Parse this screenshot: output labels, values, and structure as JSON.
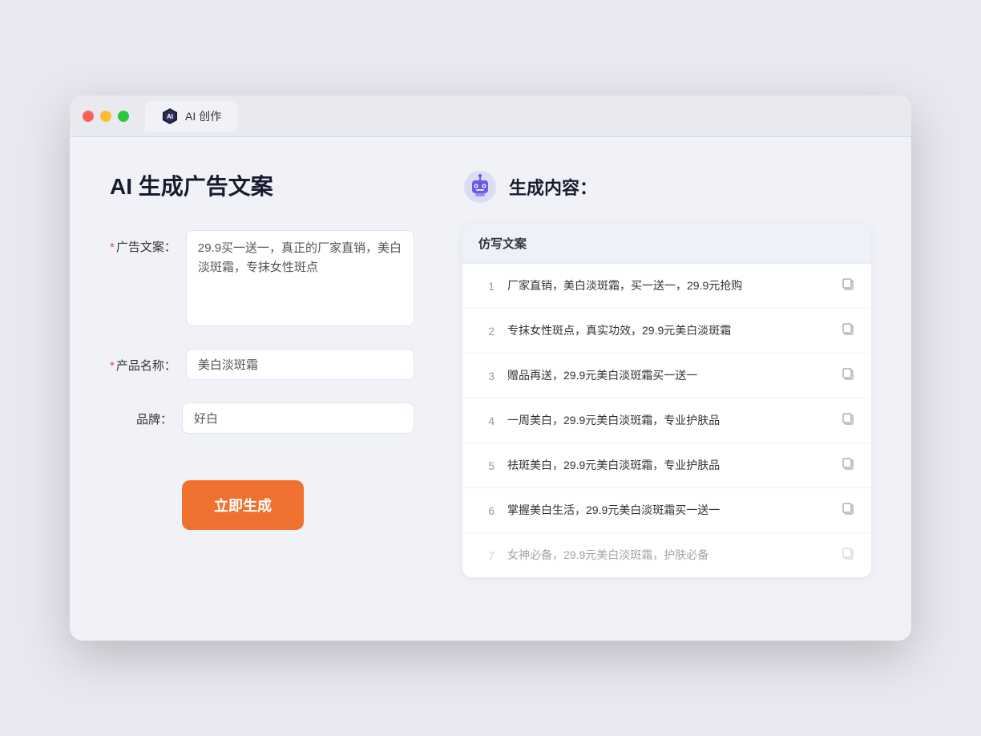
{
  "window": {
    "tab_label": "AI 创作"
  },
  "left_panel": {
    "title": "AI 生成广告文案",
    "ad_copy_label": "广告文案：",
    "ad_copy_required": "*",
    "ad_copy_value": "29.9买一送一，真正的厂家直销，美白淡斑霜，专抹女性斑点",
    "product_name_label": "产品名称：",
    "product_name_required": "*",
    "product_name_value": "美白淡斑霜",
    "brand_label": "品牌：",
    "brand_value": "好白",
    "generate_btn_label": "立即生成"
  },
  "right_panel": {
    "title": "生成内容：",
    "results_header": "仿写文案",
    "results": [
      {
        "number": "1",
        "text": "厂家直销，美白淡斑霜，买一送一，29.9元抢购",
        "dimmed": false
      },
      {
        "number": "2",
        "text": "专抹女性斑点，真实功效，29.9元美白淡斑霜",
        "dimmed": false
      },
      {
        "number": "3",
        "text": "赠品再送，29.9元美白淡斑霜买一送一",
        "dimmed": false
      },
      {
        "number": "4",
        "text": "一周美白，29.9元美白淡斑霜，专业护肤品",
        "dimmed": false
      },
      {
        "number": "5",
        "text": "祛斑美白，29.9元美白淡斑霜，专业护肤品",
        "dimmed": false
      },
      {
        "number": "6",
        "text": "掌握美白生活，29.9元美白淡斑霜买一送一",
        "dimmed": false
      },
      {
        "number": "7",
        "text": "女神必备，29.9元美白淡斑霜，护肤必备",
        "dimmed": true
      }
    ]
  }
}
